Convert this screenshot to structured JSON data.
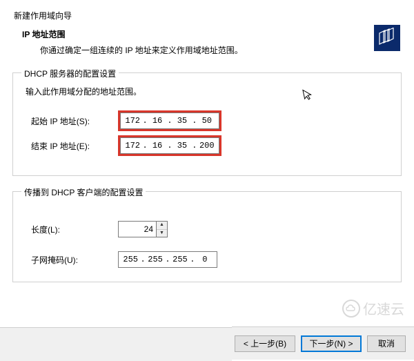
{
  "wizard_title": "新建作用域向导",
  "header": {
    "title": "IP 地址范围",
    "desc": "你通过确定一组连续的 IP 地址来定义作用域地址范围。"
  },
  "group1": {
    "legend": "DHCP 服务器的配置设置",
    "hint": "输入此作用域分配的地址范围。",
    "start_label": "起始 IP 地址(S):",
    "end_label": "结束 IP 地址(E):",
    "start_ip": {
      "o1": "172",
      "o2": "16",
      "o3": "35",
      "o4": "50"
    },
    "end_ip": {
      "o1": "172",
      "o2": "16",
      "o3": "35",
      "o4": "200"
    }
  },
  "group2": {
    "legend": "传播到 DHCP 客户端的配置设置",
    "length_label": "长度(L):",
    "length_value": "24",
    "mask_label": "子网掩码(U):",
    "mask_ip": {
      "o1": "255",
      "o2": "255",
      "o3": "255",
      "o4": "0"
    }
  },
  "footer": {
    "back": "< 上一步(B)",
    "next": "下一步(N) >",
    "cancel": "取消"
  },
  "watermark": {
    "text": "亿速云"
  },
  "dot": "."
}
